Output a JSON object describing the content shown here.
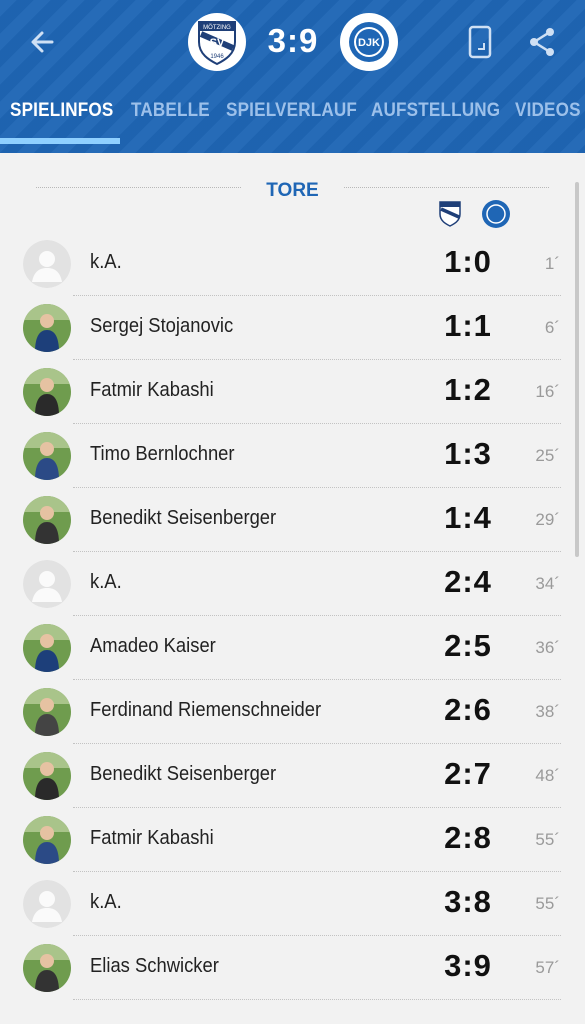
{
  "header": {
    "score": "3:9",
    "home_crest": {
      "top": "MÖTZING",
      "label": "SV",
      "bottom": "1946"
    },
    "away_crest": {
      "label": "DJK"
    }
  },
  "tabs": [
    {
      "label": "SPIELINFOS",
      "active": true
    },
    {
      "label": "TABELLE",
      "active": false
    },
    {
      "label": "SPIELVERLAUF",
      "active": false
    },
    {
      "label": "AUFSTELLUNG",
      "active": false
    },
    {
      "label": "VIDEOS",
      "active": false
    }
  ],
  "goals": {
    "title": "TORE",
    "rows": [
      {
        "name": "k.A.",
        "score": "1:0",
        "minute": "1´",
        "photo": false
      },
      {
        "name": "Sergej Stojanovic",
        "score": "1:1",
        "minute": "6´",
        "photo": true
      },
      {
        "name": "Fatmir Kabashi",
        "score": "1:2",
        "minute": "16´",
        "photo": true
      },
      {
        "name": "Timo Bernlochner",
        "score": "1:3",
        "minute": "25´",
        "photo": true
      },
      {
        "name": "Benedikt Seisenberger",
        "score": "1:4",
        "minute": "29´",
        "photo": true
      },
      {
        "name": "k.A.",
        "score": "2:4",
        "minute": "34´",
        "photo": false
      },
      {
        "name": "Amadeo Kaiser",
        "score": "2:5",
        "minute": "36´",
        "photo": true
      },
      {
        "name": "Ferdinand Riemenschneider",
        "score": "2:6",
        "minute": "38´",
        "photo": true
      },
      {
        "name": "Benedikt Seisenberger",
        "score": "2:7",
        "minute": "48´",
        "photo": true
      },
      {
        "name": "Fatmir Kabashi",
        "score": "2:8",
        "minute": "55´",
        "photo": true
      },
      {
        "name": "k.A.",
        "score": "3:8",
        "minute": "55´",
        "photo": false
      },
      {
        "name": "Elias Schwicker",
        "score": "3:9",
        "minute": "57´",
        "photo": true
      }
    ]
  },
  "colors": {
    "brand_blue": "#1f66b5",
    "tab_inactive": "#9cc0ea"
  },
  "icons": {
    "back": "arrow-left-icon",
    "device": "phone-rotate-icon",
    "share": "share-icon"
  }
}
